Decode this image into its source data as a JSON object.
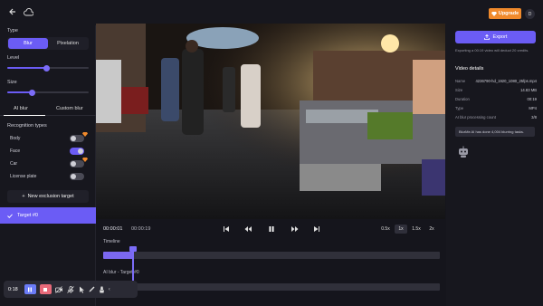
{
  "header": {
    "upgrade_label": "Upgrade",
    "avatar_initial": "D",
    "accent": "#f08a2c"
  },
  "left": {
    "type_label": "Type",
    "type_options": [
      "Blur",
      "Pixelation"
    ],
    "type_selected": "Blur",
    "level_label": "Level",
    "level_value": 0.48,
    "size_label": "Size",
    "size_value": 0.3,
    "tabs": [
      "AI blur",
      "Custom blur"
    ],
    "recognition_label": "Recognition types",
    "recognition": [
      {
        "name": "Body",
        "on": false
      },
      {
        "name": "Face",
        "on": true
      },
      {
        "name": "Car",
        "on": false
      },
      {
        "name": "License plate",
        "on": false
      }
    ],
    "new_target_label": "New exclusion target",
    "target_label": "Target #0"
  },
  "player": {
    "current_time": "00:00:01",
    "total_time": "00:00:19",
    "speeds": [
      "0.5x",
      "1x",
      "1.5x",
      "2x"
    ],
    "speed_selected": "1x",
    "timeline_label": "Timeline",
    "ai_blur_label": "AI blur - Target #0",
    "timeline_progress": 0.09
  },
  "recorder": {
    "time": "0:18"
  },
  "right": {
    "export_label": "Export",
    "note": "Exporting a 00:19 video will deduct 20 credits.",
    "details_title": "Video details",
    "details": [
      {
        "k": "Name",
        "v": "4236790-hd_1920_1080_25fps.mp4"
      },
      {
        "k": "Size",
        "v": "14.83 MB"
      },
      {
        "k": "Duration",
        "v": "00:19"
      },
      {
        "k": "Type",
        "v": "MP4"
      },
      {
        "k": "AI blur processing count",
        "v": "3/8"
      }
    ],
    "badge": "BlurMe AI has done 4,004 blurring tasks."
  },
  "colors": {
    "primary": "#6b5cf5",
    "background": "#15151c",
    "upgrade": "#f08a2c"
  }
}
